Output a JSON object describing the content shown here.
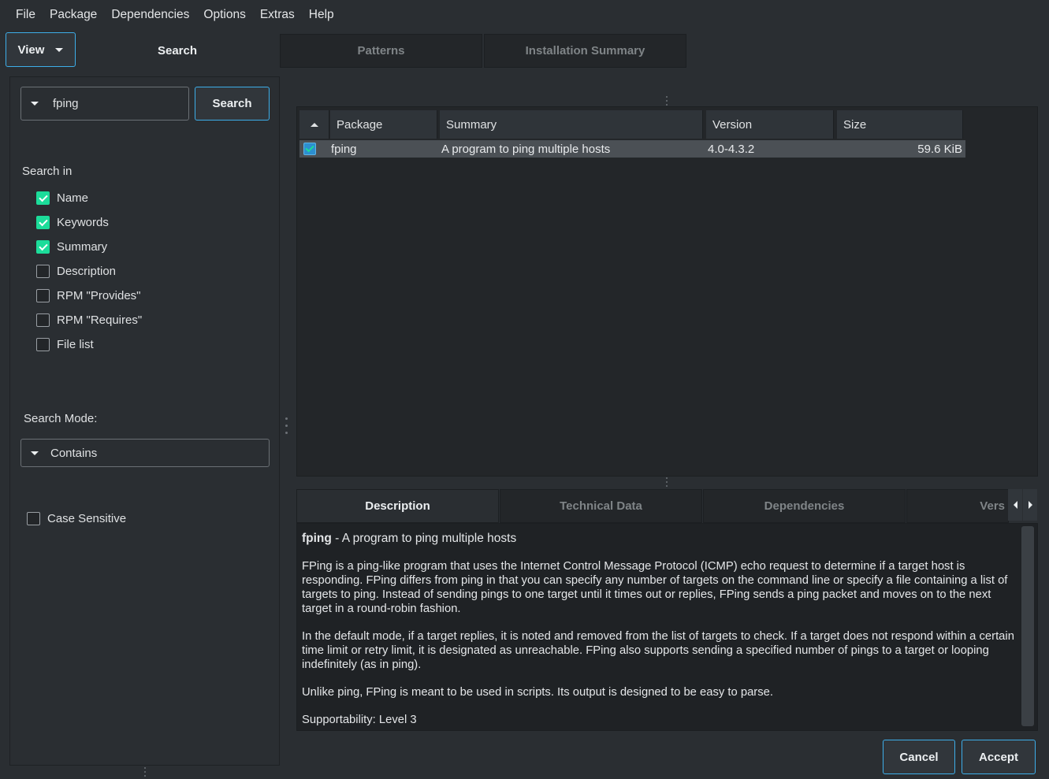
{
  "menu": [
    "File",
    "Package",
    "Dependencies",
    "Options",
    "Extras",
    "Help"
  ],
  "view_button": "View",
  "top_tabs": {
    "search": "Search",
    "patterns": "Patterns",
    "installation_summary": "Installation Summary"
  },
  "search": {
    "query": "fping",
    "button": "Search",
    "search_in_label": "Search in",
    "options": [
      {
        "label": "Name",
        "checked": true
      },
      {
        "label": "Keywords",
        "checked": true
      },
      {
        "label": "Summary",
        "checked": true
      },
      {
        "label": "Description",
        "checked": false
      },
      {
        "label": "RPM \"Provides\"",
        "checked": false
      },
      {
        "label": "RPM \"Requires\"",
        "checked": false
      },
      {
        "label": "File list",
        "checked": false
      }
    ],
    "mode_label": "Search Mode:",
    "mode_value": "Contains",
    "case_sensitive": {
      "label": "Case Sensitive",
      "checked": false
    }
  },
  "table": {
    "columns": [
      "Package",
      "Summary",
      "Version",
      "Size"
    ],
    "rows": [
      {
        "checked": true,
        "package": "fping",
        "summary": "A program to ping multiple hosts",
        "version": "4.0-4.3.2",
        "size": "59.6 KiB"
      }
    ]
  },
  "detail_tabs": {
    "description": "Description",
    "technical_data": "Technical Data",
    "dependencies": "Dependencies",
    "versions": "Vers"
  },
  "description": {
    "name": "fping",
    "summary": " - A program to ping multiple hosts",
    "para1": "FPing is a ping-like program that uses the Internet Control Message Protocol (ICMP) echo request to determine if a target host is responding. FPing differs from ping in that you can specify any number of targets on the command line or specify a file containing a list of targets to ping. Instead of sending pings to one target until it times out or replies, FPing sends a ping packet and moves on to the next target in a round-robin fashion.",
    "para2": "In the default mode, if a target replies, it is noted and removed from the list of targets to check. If a target does not respond within a certain time limit or retry limit, it is designated as unreachable. FPing also supports sending a specified number of pings to a target or looping indefinitely (as in ping).",
    "para3": "Unlike ping, FPing is meant to be used in scripts. Its output is designed to be easy to parse.",
    "para4": "Supportability: Level 3"
  },
  "buttons": {
    "cancel": "Cancel",
    "accept": "Accept"
  },
  "colors": {
    "accent": "#3daee9",
    "check": "#1cdc9a",
    "background": "#2a2e32"
  }
}
